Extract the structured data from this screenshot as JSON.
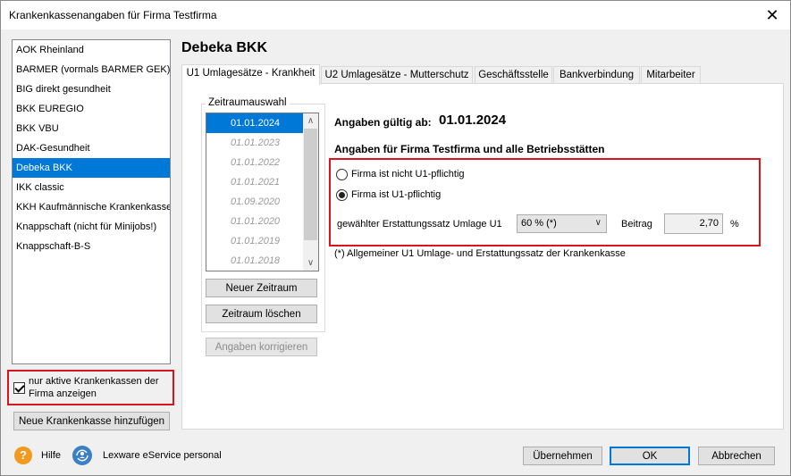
{
  "window": {
    "title": "Krankenkassenangaben für Firma Testfirma",
    "close_glyph": "✕"
  },
  "sidebar": {
    "items": [
      "AOK Rheinland",
      "BARMER (vormals BARMER GEK)",
      "BIG direkt gesundheit",
      "BKK EUREGIO",
      "BKK VBU",
      "DAK-Gesundheit",
      "Debeka BKK",
      "IKK classic",
      "KKH Kaufmännische Krankenkasse",
      "Knappschaft (nicht für Minijobs!)",
      "Knappschaft-B-S"
    ],
    "selected_index": 6,
    "only_active_label": "nur aktive Krankenkassen der Firma anzeigen",
    "only_active_checked": true,
    "add_button": "Neue Krankenkasse hinzufügen"
  },
  "panel": {
    "title": "Debeka BKK",
    "tabs": [
      "U1 Umlagesätze - Krankheit",
      "U2 Umlagesätze - Mutterschutz",
      "Geschäftsstelle",
      "Bankverbindung",
      "Mitarbeiter"
    ],
    "active_tab": 0
  },
  "zeitraum": {
    "group_label": "Zeitraumauswahl",
    "dates": [
      "01.01.2024",
      "01.01.2023",
      "01.01.2022",
      "01.01.2021",
      "01.09.2020",
      "01.01.2020",
      "01.01.2019",
      "01.01.2018"
    ],
    "selected_index": 0,
    "new_button": "Neuer Zeitraum",
    "delete_button": "Zeitraum löschen",
    "correct_button": "Angaben korrigieren",
    "scroll_up": "∧",
    "scroll_down": "∨"
  },
  "details": {
    "valid_from_label": "Angaben gültig ab:",
    "valid_from_value": "01.01.2024",
    "section_heading": "Angaben für Firma Testfirma und alle Betriebsstätten",
    "option_not_liable": "Firma ist nicht U1-pflichtig",
    "option_liable": "Firma ist U1-pflichtig",
    "selected_option": "liable",
    "rate_label": "gewählter Erstattungssatz Umlage U1",
    "rate_value": "60 % (*)",
    "contribution_label": "Beitrag",
    "contribution_value": "2,70",
    "percent_sign": "%",
    "footnote": "(*) Allgemeiner U1 Umlage- und Erstattungssatz der Krankenkasse"
  },
  "footer": {
    "help_label": "Hilfe",
    "help_glyph": "?",
    "service_label": "Lexware eService personal",
    "apply_button": "Übernehmen",
    "ok_button": "OK",
    "cancel_button": "Abbrechen"
  },
  "colors": {
    "accent": "#0078d7",
    "highlight_box": "#d9141d",
    "help_icon": "#f19a1f"
  }
}
